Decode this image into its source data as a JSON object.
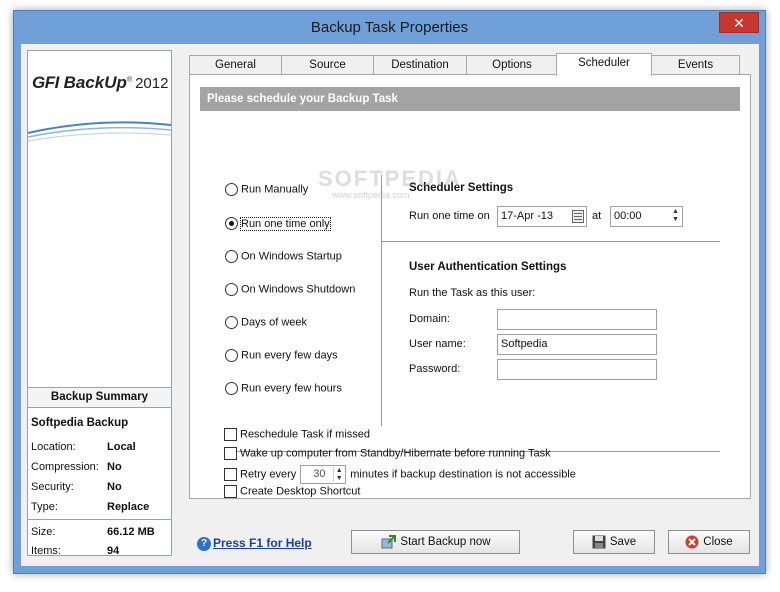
{
  "window": {
    "title": "Backup Task Properties",
    "close_glyph": "✕"
  },
  "logo": {
    "brand": "GFI",
    "product": "BackUp",
    "superscript": "®",
    "year": "2012"
  },
  "summary": {
    "header": "Backup Summary",
    "name": "Softpedia Backup",
    "rows": [
      {
        "key": "Location:",
        "value": "Local"
      },
      {
        "key": "Compression:",
        "value": "No"
      },
      {
        "key": "Security:",
        "value": "No"
      },
      {
        "key": "Type:",
        "value": "Replace"
      },
      {
        "key": "Size:",
        "value": "66.12  MB"
      },
      {
        "key": "Items:",
        "value": "94"
      }
    ]
  },
  "tabs": [
    {
      "label": "General"
    },
    {
      "label": "Source"
    },
    {
      "label": "Destination"
    },
    {
      "label": "Options"
    },
    {
      "label": "Scheduler",
      "active": true
    },
    {
      "label": "Events"
    }
  ],
  "scheduler": {
    "banner": "Please schedule your Backup Task",
    "options": [
      {
        "label": "Run Manually",
        "selected": false
      },
      {
        "label": "Run one time only",
        "selected": true
      },
      {
        "label": "On Windows Startup",
        "selected": false
      },
      {
        "label": "On Windows Shutdown",
        "selected": false
      },
      {
        "label": "Days of week",
        "selected": false
      },
      {
        "label": "Run every few days",
        "selected": false
      },
      {
        "label": "Run every few hours",
        "selected": false
      }
    ],
    "settings_header": "Scheduler Settings",
    "run_once_label": "Run one time on",
    "date_value": "17-Apr -13",
    "at_label": "at",
    "time_value": "00:00",
    "auth_header": "User Authentication Settings",
    "auth_caption": "Run the Task as this user:",
    "domain_label": "Domain:",
    "domain_value": "",
    "username_label": "User name:",
    "username_value": "Softpedia",
    "password_label": "Password:",
    "password_value": "",
    "checks": {
      "reschedule": "Reschedule Task if missed",
      "wake": "Wake up computer from Standby/Hibernate before running Task",
      "retry_prefix": "Retry every",
      "retry_value": "30",
      "retry_suffix": "minutes if backup destination is not accessible",
      "shortcut": "Create Desktop Shortcut"
    }
  },
  "footer": {
    "help_icon": "?",
    "help_label": "Press F1 for Help",
    "start_label": "Start Backup now",
    "save_label": "Save",
    "close_label": "Close"
  },
  "watermark": {
    "text": "SOFTPEDIA",
    "sub": "www.softpedia.com"
  },
  "colors": {
    "titlebar": "#6fa0d8",
    "close": "#c7372f",
    "banner": "#a3a3a3",
    "link": "#1a3ea8"
  }
}
